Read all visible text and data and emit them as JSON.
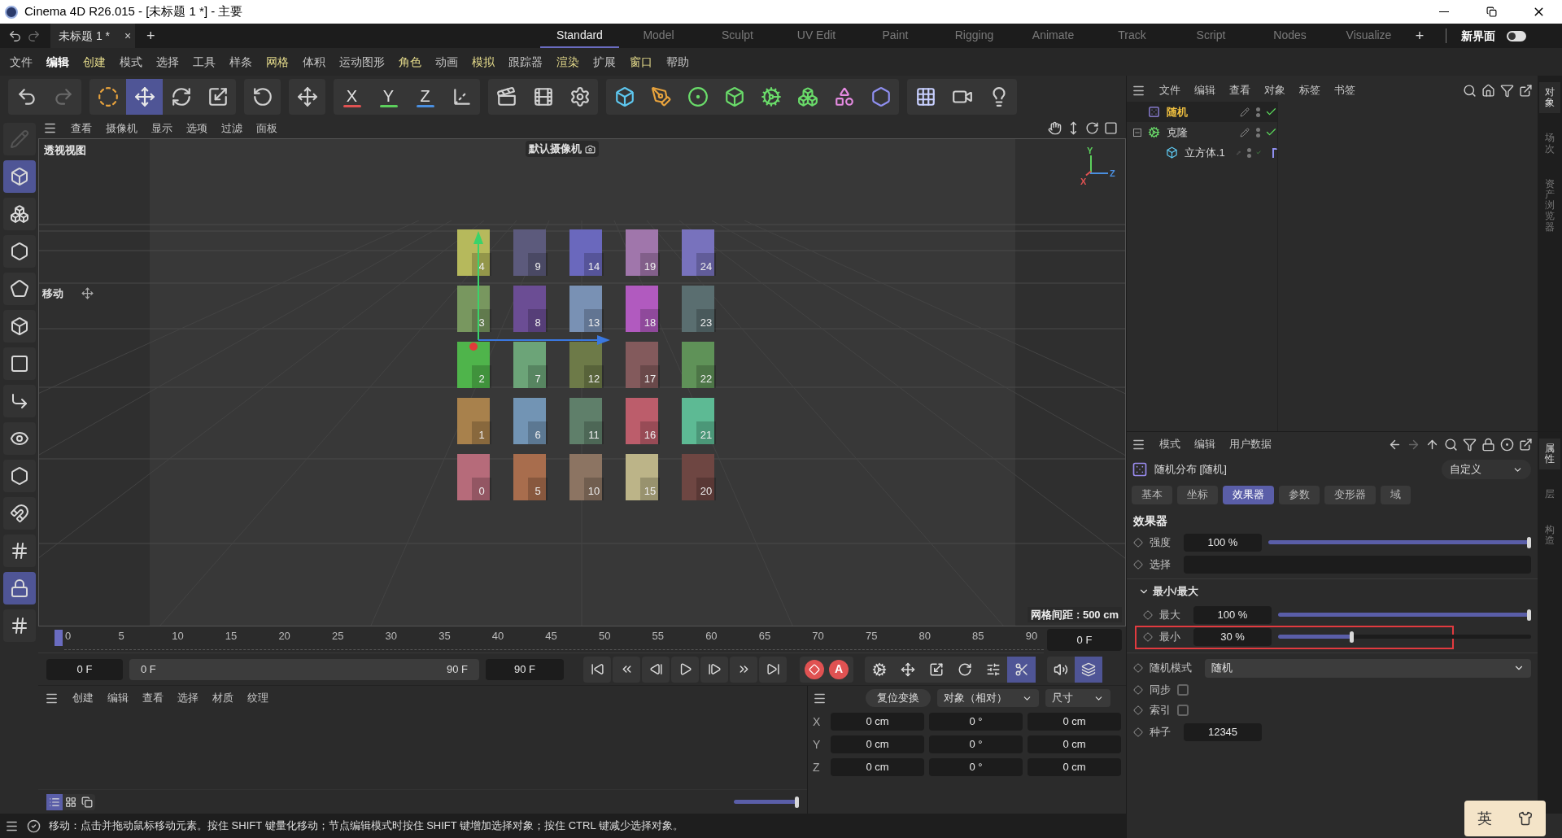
{
  "window": {
    "title": "Cinema 4D R26.015 - [未标题 1 *] - 主要"
  },
  "document_tab": {
    "label": "未标题 1 *",
    "close": "×",
    "add": "+"
  },
  "layouts": [
    {
      "label": "Standard",
      "selected": true
    },
    {
      "label": "Model",
      "selected": false
    },
    {
      "label": "Sculpt",
      "selected": false
    },
    {
      "label": "UV Edit",
      "selected": false
    },
    {
      "label": "Paint",
      "selected": false
    },
    {
      "label": "Rigging",
      "selected": false
    },
    {
      "label": "Animate",
      "selected": false
    },
    {
      "label": "Track",
      "selected": false
    },
    {
      "label": "Script",
      "selected": false
    },
    {
      "label": "Nodes",
      "selected": false
    },
    {
      "label": "Visualize",
      "selected": false
    }
  ],
  "layout_add": "+",
  "new_ui": {
    "label": "新界面",
    "on": false
  },
  "menu": [
    {
      "label": "文件",
      "accent": false,
      "active": false
    },
    {
      "label": "编辑",
      "accent": false,
      "active": true
    },
    {
      "label": "创建",
      "accent": true,
      "active": false
    },
    {
      "label": "模式",
      "accent": false,
      "active": false
    },
    {
      "label": "选择",
      "accent": false,
      "active": false
    },
    {
      "label": "工具",
      "accent": false,
      "active": false
    },
    {
      "label": "样条",
      "accent": false,
      "active": false
    },
    {
      "label": "网格",
      "accent": true,
      "active": false
    },
    {
      "label": "体积",
      "accent": false,
      "active": false
    },
    {
      "label": "运动图形",
      "accent": false,
      "active": false
    },
    {
      "label": "角色",
      "accent": true,
      "active": false
    },
    {
      "label": "动画",
      "accent": false,
      "active": false
    },
    {
      "label": "模拟",
      "accent": true,
      "active": false
    },
    {
      "label": "跟踪器",
      "accent": false,
      "active": false
    },
    {
      "label": "渲染",
      "accent": true,
      "active": false
    },
    {
      "label": "扩展",
      "accent": false,
      "active": false
    },
    {
      "label": "窗口",
      "accent": true,
      "active": false
    },
    {
      "label": "帮助",
      "accent": false,
      "active": false
    }
  ],
  "toolbar": [
    {
      "tools": [
        {
          "kind": "undo",
          "selected": false
        },
        {
          "kind": "redo",
          "selected": false
        }
      ]
    },
    {
      "tools": [
        {
          "kind": "live-select",
          "selected": false
        },
        {
          "kind": "move",
          "selected": true
        },
        {
          "kind": "rotate",
          "selected": false
        },
        {
          "kind": "scale",
          "selected": false
        }
      ]
    },
    {
      "tools": [
        {
          "kind": "recent-rotate",
          "selected": false
        }
      ]
    },
    {
      "tools": [
        {
          "kind": "move-alt",
          "selected": false
        }
      ]
    },
    {
      "tools": [
        {
          "kind": "axis",
          "label": "X",
          "color": "#e05252",
          "selected": false
        },
        {
          "kind": "axis",
          "label": "Y",
          "color": "#5ccf5c",
          "selected": false
        },
        {
          "kind": "axis",
          "label": "Z",
          "color": "#4a8fe0",
          "selected": false
        },
        {
          "kind": "coord-system",
          "selected": false
        }
      ]
    },
    {
      "tools": [
        {
          "kind": "render-view",
          "selected": false
        },
        {
          "kind": "render-picture",
          "selected": false
        },
        {
          "kind": "render-settings",
          "selected": false
        }
      ]
    },
    {
      "tools": [
        {
          "kind": "cube",
          "selected": false
        },
        {
          "kind": "pen",
          "selected": false
        },
        {
          "kind": "subdivide",
          "selected": false
        },
        {
          "kind": "generator",
          "selected": false
        },
        {
          "kind": "cloner",
          "selected": false
        },
        {
          "kind": "mograph",
          "selected": false
        },
        {
          "kind": "deformer",
          "selected": false
        },
        {
          "kind": "field",
          "selected": false
        }
      ]
    },
    {
      "tools": [
        {
          "kind": "floor",
          "selected": false
        },
        {
          "kind": "camera",
          "selected": false
        },
        {
          "kind": "light",
          "selected": false
        }
      ]
    }
  ],
  "left_tools": [
    {
      "kind": "pencil",
      "selected": false
    },
    {
      "kind": "model",
      "selected": true
    },
    {
      "kind": "texture",
      "selected": false
    },
    {
      "kind": "points",
      "selected": false
    },
    {
      "kind": "edges",
      "selected": false
    },
    {
      "kind": "polygons",
      "selected": false
    },
    {
      "kind": "uv",
      "selected": false
    },
    {
      "kind": "axis",
      "selected": false
    },
    {
      "kind": "solo",
      "selected": false
    },
    {
      "kind": "enable-axis",
      "selected": false
    },
    {
      "kind": "magnet",
      "selected": false
    },
    {
      "kind": "snap",
      "selected": false
    },
    {
      "kind": "snap-lock",
      "selected": true
    },
    {
      "kind": "snap-auto",
      "selected": false
    }
  ],
  "viewport_menu": [
    "查看",
    "摄像机",
    "显示",
    "选项",
    "过滤",
    "面板"
  ],
  "viewport": {
    "name": "透视视图",
    "camera": "默认摄像机",
    "tool_label": "移动",
    "grid_spacing": "网格间距 : 500 cm",
    "gizmo": {
      "y": "Y",
      "x": "X",
      "z": "Z"
    },
    "cubes": [
      {
        "label": "4",
        "color": "#b6b95c"
      },
      {
        "label": "9",
        "color": "#5c5a7c"
      },
      {
        "label": "14",
        "color": "#6a68bd"
      },
      {
        "label": "19",
        "color": "#a076ab"
      },
      {
        "label": "24",
        "color": "#7872bd"
      },
      {
        "label": "3",
        "color": "#78975f"
      },
      {
        "label": "8",
        "color": "#6b4d94"
      },
      {
        "label": "13",
        "color": "#7991b4"
      },
      {
        "label": "18",
        "color": "#b15abf"
      },
      {
        "label": "23",
        "color": "#5a6e70"
      },
      {
        "label": "2",
        "color": "#4fb44b"
      },
      {
        "label": "7",
        "color": "#6ca478"
      },
      {
        "label": "12",
        "color": "#6d7a48"
      },
      {
        "label": "17",
        "color": "#835a5c"
      },
      {
        "label": "22",
        "color": "#5f9258"
      },
      {
        "label": "1",
        "color": "#a8814c"
      },
      {
        "label": "6",
        "color": "#7294b4"
      },
      {
        "label": "11",
        "color": "#5f7f6a"
      },
      {
        "label": "16",
        "color": "#bc5d6b"
      },
      {
        "label": "21",
        "color": "#5dba94"
      },
      {
        "label": "0",
        "color": "#b66b7a"
      },
      {
        "label": "5",
        "color": "#a86d4d"
      },
      {
        "label": "10",
        "color": "#8c7462"
      },
      {
        "label": "15",
        "color": "#bcb488"
      },
      {
        "label": "20",
        "color": "#6e4642"
      }
    ]
  },
  "timeline": {
    "ticks": [
      "0",
      "5",
      "10",
      "15",
      "20",
      "25",
      "30",
      "35",
      "40",
      "45",
      "50",
      "55",
      "60",
      "65",
      "70",
      "75",
      "80",
      "85",
      "90"
    ],
    "current": "0 F",
    "start": "0 F",
    "range_start": "0 F",
    "range_end": "90 F",
    "end": "90 F"
  },
  "transport": [
    {
      "kind": "go-start"
    },
    {
      "kind": "prev-key"
    },
    {
      "kind": "prev-frame"
    },
    {
      "kind": "play"
    },
    {
      "kind": "next-frame"
    },
    {
      "kind": "next-key"
    },
    {
      "kind": "go-end"
    }
  ],
  "record": {
    "autokey": "A"
  },
  "key_toggles": [
    {
      "kind": "settings",
      "on": false
    },
    {
      "kind": "position",
      "on": false
    },
    {
      "kind": "scale",
      "on": false
    },
    {
      "kind": "rotation",
      "on": false
    },
    {
      "kind": "parameter",
      "on": false
    },
    {
      "kind": "pla",
      "on": true
    }
  ],
  "sound_toggles": [
    {
      "kind": "sound",
      "on": false
    },
    {
      "kind": "dope",
      "on": true
    }
  ],
  "material_menu": [
    "创建",
    "编辑",
    "查看",
    "选择",
    "材质",
    "纹理"
  ],
  "material_views": [
    {
      "kind": "list",
      "selected": true
    },
    {
      "kind": "grid",
      "selected": false
    },
    {
      "kind": "stack",
      "selected": false
    }
  ],
  "material_zoom": {
    "level": 1
  },
  "coordinates": {
    "reset": "复位变换",
    "mode": "对象（相对）",
    "size": "尺寸",
    "rows": [
      {
        "axis": "X",
        "values": [
          "0 cm",
          "0 °",
          "0 cm"
        ]
      },
      {
        "axis": "Y",
        "values": [
          "0 cm",
          "0 °",
          "0 cm"
        ]
      },
      {
        "axis": "Z",
        "values": [
          "0 cm",
          "0 °",
          "0 cm"
        ]
      }
    ]
  },
  "status_bar": "移动：点击并拖动鼠标移动元素。按住 SHIFT 键量化移动；节点编辑模式时按住 SHIFT 键增加选择对象；按住 CTRL 键减少选择对象。",
  "object_manager": {
    "menu": [
      "文件",
      "编辑",
      "查看",
      "对象",
      "标签",
      "书签"
    ],
    "objects": [
      {
        "name": "随机",
        "kind": "effector",
        "selected": true,
        "enabled": true
      },
      {
        "name": "克隆",
        "kind": "cloner",
        "selected": false,
        "enabled": true,
        "expanded": true,
        "children": [
          {
            "name": "立方体.1",
            "kind": "cube",
            "selected": false,
            "enabled": true,
            "tags": [
              {
                "kind": "phong"
              }
            ]
          }
        ]
      }
    ]
  },
  "side_tabs_top": [
    {
      "label": "对象",
      "selected": true
    },
    {
      "label": "场次",
      "selected": false
    },
    {
      "label": "资产浏览器",
      "selected": false
    }
  ],
  "attributes": {
    "menu": [
      "模式",
      "编辑",
      "用户数据"
    ],
    "title": "随机分布 [随机]",
    "preset": "自定义",
    "tabs": [
      {
        "label": "基本",
        "selected": false
      },
      {
        "label": "坐标",
        "selected": false
      },
      {
        "label": "效果器",
        "selected": true
      },
      {
        "label": "参数",
        "selected": false
      },
      {
        "label": "变形器",
        "selected": false
      },
      {
        "label": "域",
        "selected": false
      }
    ],
    "section": "效果器",
    "params": [
      {
        "kind": "slider",
        "label": "强度",
        "value": "100 %",
        "level": 1,
        "highlighted": false
      },
      {
        "kind": "field",
        "label": "选择"
      },
      {
        "kind": "group",
        "label": "最小/最大",
        "expanded": true,
        "children": [
          {
            "kind": "slider",
            "label": "最大",
            "value": "100 %",
            "level": 1,
            "highlighted": false
          },
          {
            "kind": "slider",
            "label": "最小",
            "value": "30 %",
            "level": 0.3,
            "highlighted": true
          }
        ]
      },
      {
        "kind": "dropdown",
        "label": "随机模式",
        "value": "随机"
      },
      {
        "kind": "checkbox",
        "label": "同步",
        "checked": false
      },
      {
        "kind": "checkbox",
        "label": "索引",
        "checked": false
      },
      {
        "kind": "number",
        "label": "种子",
        "value": "12345"
      }
    ]
  },
  "side_tabs_bottom": [
    {
      "label": "属性",
      "selected": true
    },
    {
      "label": "层",
      "selected": false
    },
    {
      "label": "构造",
      "selected": false
    }
  ],
  "ime": {
    "label": "英"
  }
}
